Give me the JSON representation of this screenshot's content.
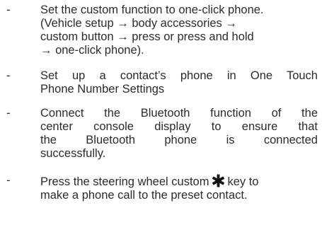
{
  "items": [
    {
      "bullet": "-",
      "lines": [
        "Set the custom function to one-click phone.",
        "(Vehicle setup → body accessories →",
        "custom button → press or press and hold",
        "→ one-click phone)."
      ]
    },
    {
      "bullet": "-",
      "lines": [
        "Set up a contact’s phone in One Touch",
        "Phone Number Settings"
      ]
    },
    {
      "bullet": "-",
      "lines": [
        "Connect the Bluetooth function of the",
        "center console display to ensure that",
        "the Bluetooth phone is connected",
        "successfully."
      ]
    },
    {
      "bullet": "-",
      "lines_before_icon": "Press the steering wheel custom",
      "icon": "asterisk-star-icon",
      "lines_after_icon": "key to",
      "lines": [
        "make a phone call to the preset contact."
      ]
    }
  ]
}
